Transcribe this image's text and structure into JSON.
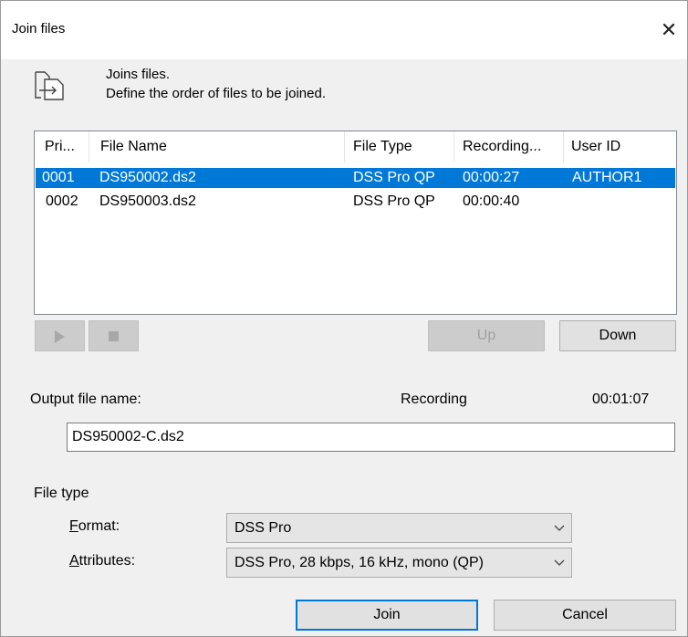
{
  "window": {
    "title": "Join files",
    "close_glyph": "✕"
  },
  "header": {
    "line1": "Joins files.",
    "line2": "Define the order of files to be joined.",
    "icon": "join-files-icon"
  },
  "list": {
    "columns": [
      "Pri...",
      "File Name",
      "File Type",
      "Recording...",
      "User ID"
    ],
    "rows": [
      {
        "priority": "0001",
        "file_name": "DS950002.ds2",
        "file_type": "DSS Pro QP",
        "recording": "00:00:27",
        "user_id": "AUTHOR1",
        "selected": true
      },
      {
        "priority": "0002",
        "file_name": "DS950003.ds2",
        "file_type": "DSS Pro QP",
        "recording": "00:00:40",
        "user_id": "",
        "selected": false
      }
    ]
  },
  "controls": {
    "play_icon": "play-icon",
    "stop_icon": "stop-icon",
    "up_label": "Up",
    "down_label": "Down"
  },
  "output": {
    "label": "Output file name:",
    "recording_label": "Recording",
    "recording_time": "00:01:07",
    "file_name": "DS950002-C.ds2"
  },
  "file_type": {
    "group_label": "File type",
    "format_label": "Format:",
    "format_value": "DSS Pro",
    "attributes_label": "Attributes:",
    "attributes_value": "DSS Pro, 28 kbps, 16 kHz, mono (QP)"
  },
  "actions": {
    "join_label": "Join",
    "cancel_label": "Cancel"
  },
  "colors": {
    "selection": "#0078d7",
    "dialog_bg": "#f0f0f0"
  }
}
